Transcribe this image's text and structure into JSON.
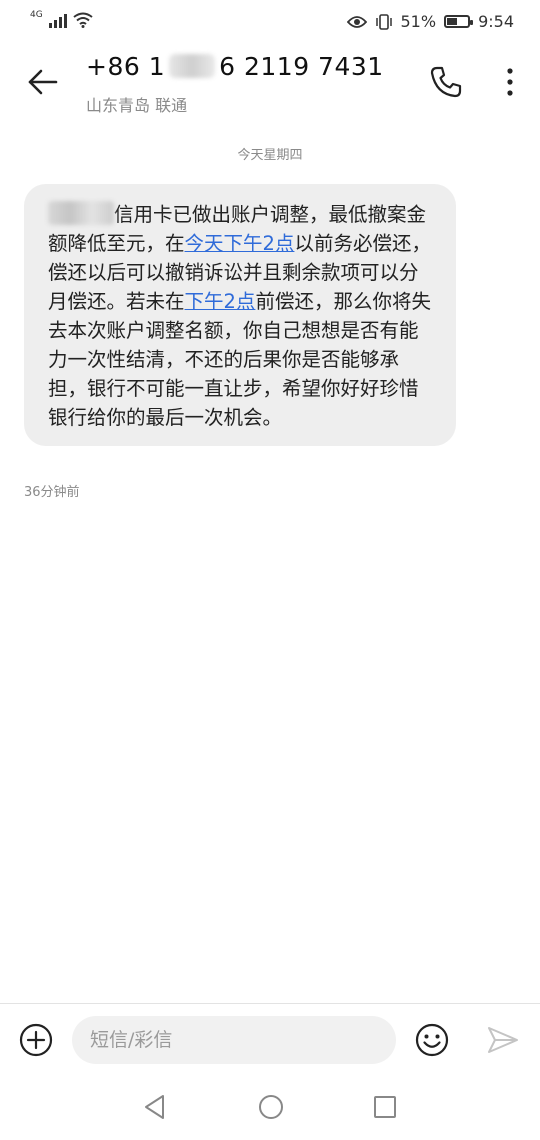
{
  "status_bar": {
    "network": "4G",
    "battery": "51%",
    "battery_level": 0.51,
    "time": "9:54",
    "icons": [
      "signal-icon",
      "wifi-icon",
      "eye-icon",
      "vibrate-icon",
      "battery-icon"
    ]
  },
  "header": {
    "number_prefix": "+86 1",
    "number_suffix": "6 2119 7431",
    "location": "山东青岛 联通",
    "icons": [
      "back-arrow-icon",
      "phone-icon",
      "more-vertical-icon"
    ]
  },
  "conversation": {
    "date_separator": "今天星期四",
    "message": {
      "part1": "信用卡已做出账户调整，最低撤案金额降低至元，在",
      "link1": "今天下午2点",
      "part2": "以前务必偿还，偿还以后可以撤销诉讼并且剩余款项可以分月偿还。若未在",
      "link2": "下午2点",
      "part3": "前偿还，那么你将失去本次账户调整名额，你自己想想是否有能力一次性结清，不还的后果你是否能够承担，银行不可能一直让步，希望你好好珍惜银行给你的最后一次机会。"
    },
    "time_ago": "36分钟前"
  },
  "input_bar": {
    "placeholder": "短信/彩信",
    "icons": [
      "add-circle-icon",
      "emoji-icon",
      "send-icon"
    ]
  },
  "nav_bar": {
    "icons": [
      "nav-back-icon",
      "nav-home-icon",
      "nav-recent-icon"
    ]
  },
  "colors": {
    "link": "#2f6bd9",
    "bubble_bg": "#eeeeee",
    "secondary_text": "#8a8a8a"
  }
}
